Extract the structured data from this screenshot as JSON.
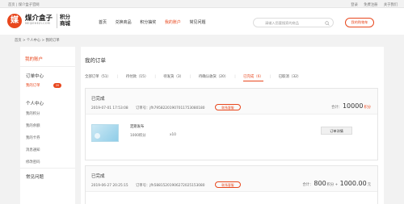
{
  "topbar": {
    "left": "首页 | 煤介盒子官网",
    "links": [
      "登录",
      "免费注册",
      "关于我们"
    ]
  },
  "logo": {
    "mark": "媒",
    "name": "煤介盒子",
    "domain": "MEIJIEHEZI.COM",
    "mall": "积分商城"
  },
  "nav": {
    "items": [
      "首页",
      "兑换商品",
      "积分抽奖",
      "我的账户",
      "常见问题"
    ],
    "active_index": 3
  },
  "search": {
    "placeholder": "请输入您要搜索的商品"
  },
  "cart": {
    "label": "我的购物车"
  },
  "breadcrumb": "首页 > 个人中心 > 我的订单",
  "sidebar": {
    "title": "我的账户",
    "order_center": "订单中心",
    "my_orders": "我的订单",
    "badge": "20",
    "personal_center": "个人中心",
    "items": [
      "我的积分",
      "我的余额",
      "我的卡券",
      "消息通知",
      "修改密码"
    ],
    "faq": "常见问题"
  },
  "main": {
    "title": "我的订单",
    "tabs": [
      "全部订单（51）",
      "待付款（15）",
      "待发货（3）",
      "待确认收货（20）",
      "已完成（6）",
      "已取消（32）"
    ],
    "active_tab": 4,
    "orders": [
      {
        "status": "已完成",
        "date": "2019-07-01 17:53:08",
        "number": "订单号：jfh79582201907011753080180",
        "contact": "联系客服",
        "total_label": "合计：",
        "total_value": "10000",
        "total_unit": "积分",
        "product_name": "定期发布",
        "product_points": "1000积分",
        "product_qty": "x10",
        "detail_button": "订单详情"
      },
      {
        "status": "已完成",
        "date": "2019-06-27 20:25:15",
        "number": "订单号：jfh58815201906272025153080",
        "contact": "联系客服",
        "total_label": "合计：",
        "total_value": "800",
        "total_mid": "积分 + ",
        "total_value2": "1000.00",
        "total_unit": "元"
      }
    ]
  },
  "colors": {
    "accent": "#e8471d",
    "bg": "#f2f2f2"
  }
}
